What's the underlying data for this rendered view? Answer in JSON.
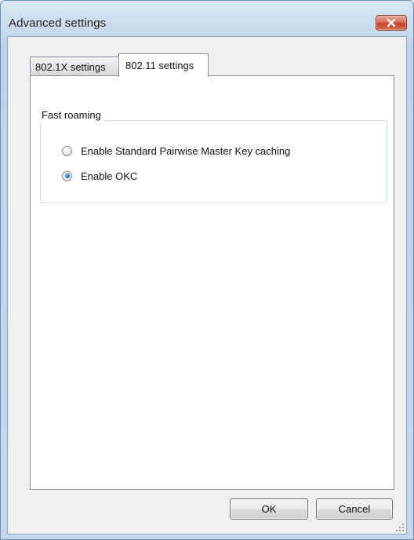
{
  "window": {
    "title": "Advanced settings"
  },
  "tabs": [
    {
      "label": "802.1X settings",
      "active": false
    },
    {
      "label": "802.11 settings",
      "active": true
    }
  ],
  "fast_roaming": {
    "group_title": "Fast roaming",
    "options": [
      {
        "label": "Enable Standard Pairwise Master Key caching",
        "checked": false
      },
      {
        "label": "Enable OKC",
        "checked": true
      }
    ]
  },
  "buttons": {
    "ok_label": "OK",
    "cancel_label": "Cancel"
  },
  "icons": {
    "close": "close-icon",
    "resize": "resize-grip-icon"
  },
  "colors": {
    "close_button": "#c5432a",
    "frame": "#c3d6ec",
    "radio_checked": "#2d6fb6"
  }
}
